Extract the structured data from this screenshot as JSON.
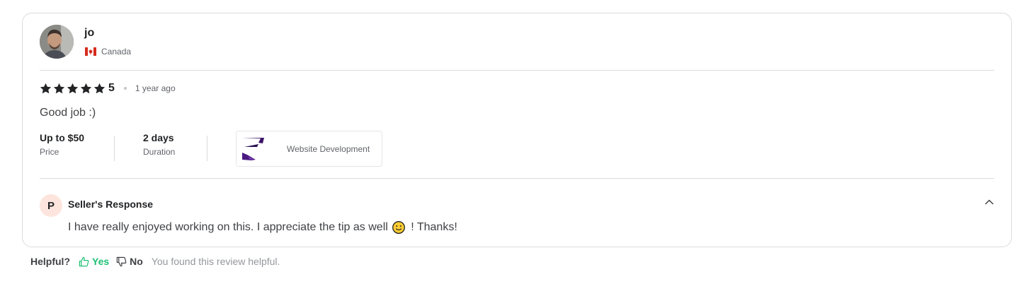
{
  "review": {
    "reviewer_name": "jo",
    "avatar_alt": "reviewer photo",
    "country": "Canada",
    "country_flag": "canada-flag-icon",
    "rating": "5",
    "stars": 5,
    "time_ago": "1 year ago",
    "text": "Good job :)",
    "price_value": "Up to $50",
    "price_label": "Price",
    "duration_value": "2 days",
    "duration_label": "Duration",
    "gig_title": "Website Development"
  },
  "seller_response": {
    "avatar_letter": "P",
    "title": "Seller's Response",
    "text_before": "I have really enjoyed working on this. I appreciate the tip as well",
    "text_after": " ! Thanks!",
    "emoji": "slightly-smiling-face-icon"
  },
  "helpful": {
    "question": "Helpful?",
    "yes_label": "Yes",
    "no_label": "No",
    "note": "You found this review helpful."
  },
  "colors": {
    "accent_green": "#1dbf73",
    "star": "#222325",
    "response_avatar_bg": "#fde5dd",
    "border": "#dadbdd"
  }
}
